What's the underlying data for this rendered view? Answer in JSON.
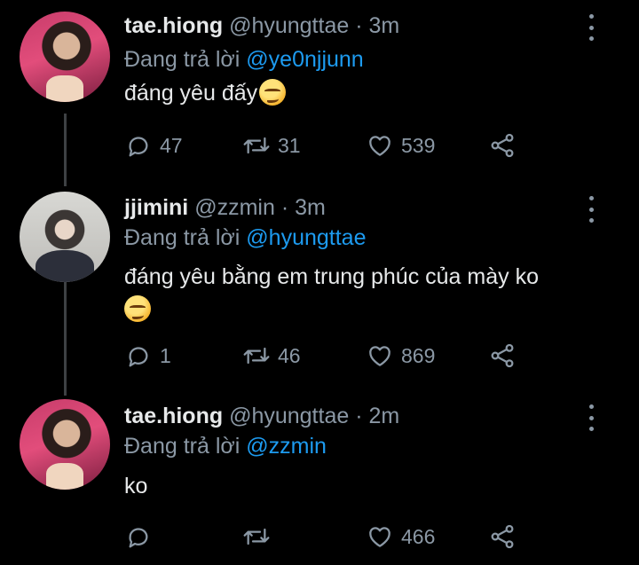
{
  "tweets": [
    {
      "display_name": "tae.hiong",
      "handle": "@hyungttae",
      "separator": "·",
      "time": "3m",
      "reply_prefix": "Đang trả lời",
      "reply_to": "@ye0njjunn",
      "text": "đáng yêu đấy",
      "replies": "47",
      "retweets": "31",
      "likes": "539"
    },
    {
      "display_name": "jjimini",
      "handle": "@zzmin",
      "separator": "·",
      "time": "3m",
      "reply_prefix": "Đang trả lời",
      "reply_to": "@hyungttae",
      "text": "đáng yêu bằng em trung phúc của mày ko",
      "replies": "1",
      "retweets": "46",
      "likes": "869"
    },
    {
      "display_name": "tae.hiong",
      "handle": "@hyungttae",
      "separator": "·",
      "time": "2m",
      "reply_prefix": "Đang trả lời",
      "reply_to": "@zzmin",
      "text": "ko",
      "replies": "",
      "retweets": "",
      "likes": "466"
    }
  ],
  "icons": {
    "reply": "reply-icon",
    "retweet": "retweet-icon",
    "like": "heart-icon",
    "share": "share-icon",
    "more": "more-vertical-icon",
    "emoji": "smirking-face-emoji"
  },
  "colors": {
    "background": "#000000",
    "text": "#e7e9ea",
    "muted": "#8b98a5",
    "mention": "#1d9bf0",
    "thread_line": "#3e4144"
  }
}
